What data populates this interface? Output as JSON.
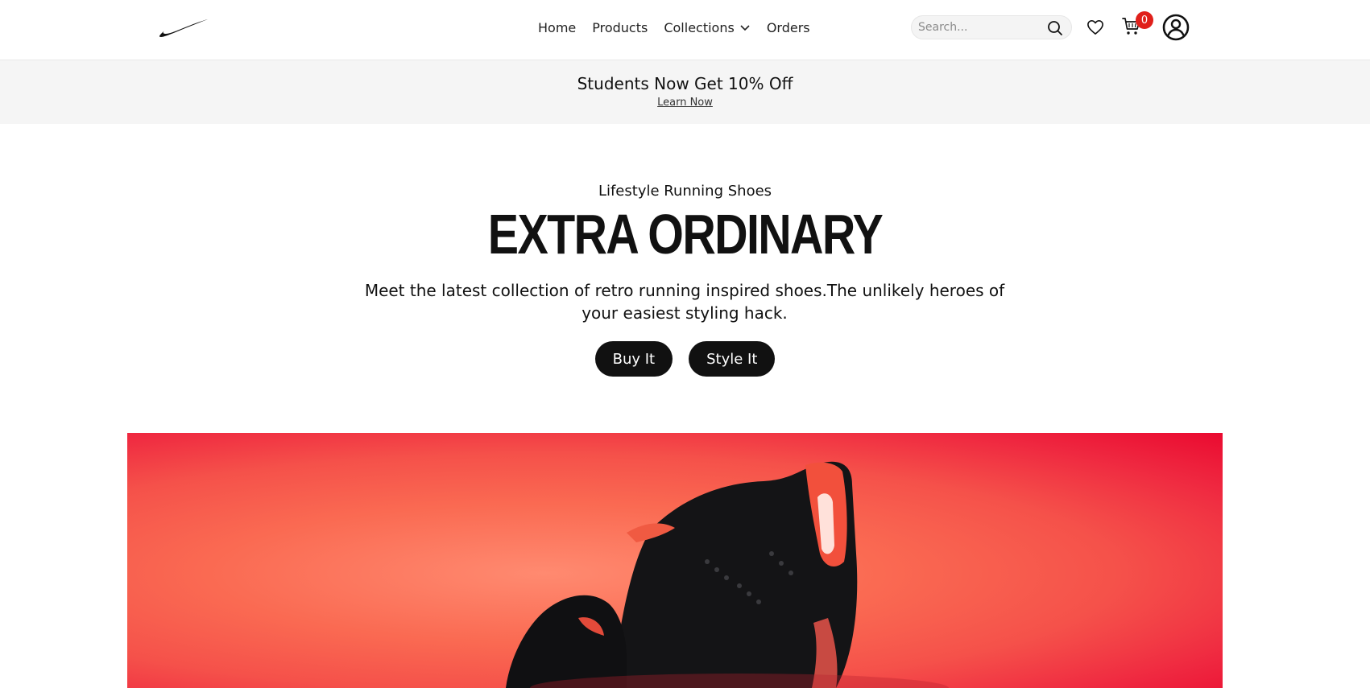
{
  "nav": {
    "logo_icon": "nike-swoosh-icon",
    "links": [
      {
        "label": "Home"
      },
      {
        "label": "Products"
      },
      {
        "label": "Collections",
        "has_dropdown": true
      },
      {
        "label": "Orders"
      }
    ],
    "search": {
      "placeholder": "Search...",
      "icon": "search-icon"
    },
    "wishlist_icon": "heart-icon",
    "cart": {
      "icon": "cart-icon",
      "count": "0"
    },
    "account_icon": "account-icon"
  },
  "promo": {
    "title": "Students Now Get 10% Off",
    "link": "Learn Now"
  },
  "hero": {
    "subtitle": "Lifestyle Running Shoes",
    "title": "EXTRA ORDINARY",
    "description": "Meet the latest collection of retro running inspired shoes.The unlikely heroes of your easiest styling hack.",
    "buttons": [
      {
        "label": "Buy It"
      },
      {
        "label": "Style It"
      }
    ]
  },
  "colors": {
    "accent": "#111111",
    "badge": "#e0201b",
    "promo_bg": "#f5f5f5",
    "image_red": "#ea0a30",
    "image_coral": "#fa6a52"
  }
}
